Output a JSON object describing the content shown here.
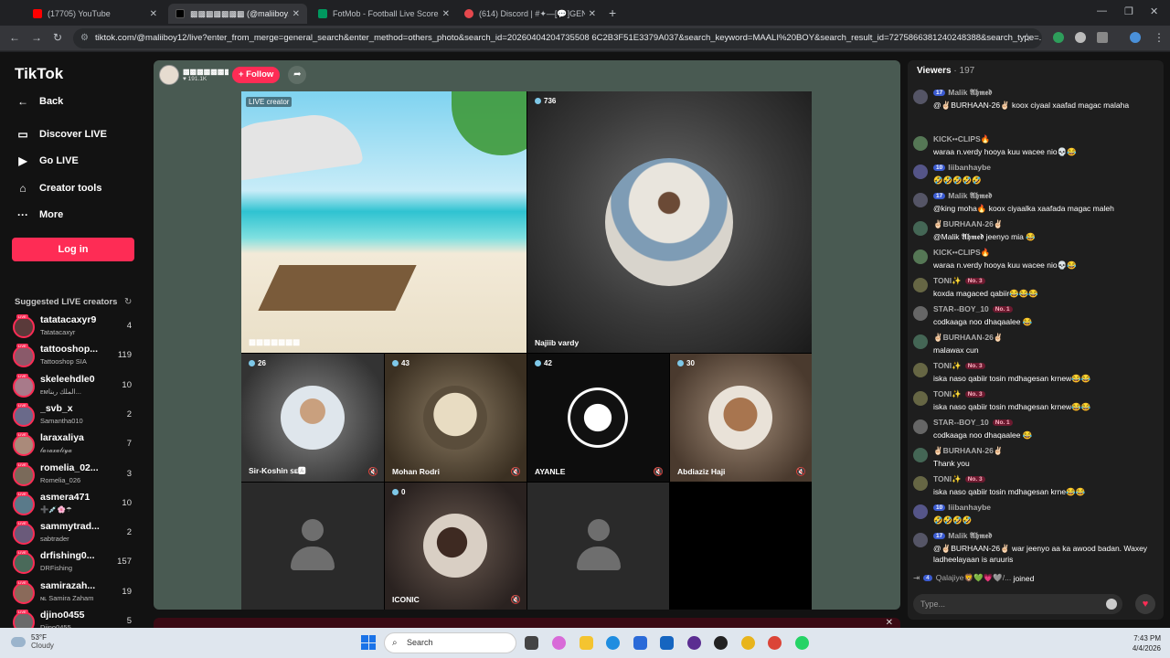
{
  "browser": {
    "tabs": [
      {
        "title": "(17705) YouTube",
        "color": "#ff0000"
      },
      {
        "title": "▩▩▩▩▩▩▩ (@maliiboy12...",
        "color": "#000000"
      },
      {
        "title": "FotMob - Football Live Scores",
        "color": "#00985f"
      },
      {
        "title": "(614) Discord | #✦—[💬]GENERAL",
        "color": "#5865f2"
      }
    ],
    "url": "tiktok.com/@maliiboy12/live?enter_from_merge=general_search&enter_method=others_photo&search_id=20260404204735508 6C2B3F51E3379A037&search_keyword=MAALI%20BOY&search_result_id=7275866381240248388&search_type=..."
  },
  "sidebar": {
    "logo": "TikTok",
    "nav": [
      {
        "label": "Back",
        "icon": "back-arrow-icon"
      },
      {
        "label": "Discover LIVE",
        "icon": "discover-live-icon"
      },
      {
        "label": "Go LIVE",
        "icon": "go-live-icon"
      },
      {
        "label": "Creator tools",
        "icon": "creator-tools-icon"
      },
      {
        "label": "More",
        "icon": "more-icon"
      }
    ],
    "login": "Log in",
    "suggested_heading": "Suggested LIVE creators",
    "creators": [
      {
        "name": "tatatacaxyr9",
        "sub": "Tatatacaxyr",
        "count": "4"
      },
      {
        "name": "tattooshop...",
        "sub": "Tattooshop SIA",
        "count": "119"
      },
      {
        "name": "skeleehdle0",
        "sub": "ᴇᴍالملك ربنا...",
        "count": "10"
      },
      {
        "name": "_svb_x",
        "sub": "Samantha010",
        "count": "2"
      },
      {
        "name": "laraxaliya",
        "sub": "𝓁𝒶𝓇𝒶𝓍𝒶𝓁𝒾𝓎𝒶",
        "count": "7"
      },
      {
        "name": "romelia_02...",
        "sub": "Romelia_026",
        "count": "3"
      },
      {
        "name": "asmera471",
        "sub": "➕💉🌸☂",
        "count": "10"
      },
      {
        "name": "sammytrad...",
        "sub": "sabtrader",
        "count": "2"
      },
      {
        "name": "drfishing0...",
        "sub": "DRFishing",
        "count": "157"
      },
      {
        "name": "samirazah...",
        "sub": "ɴʟ Samira Zaham",
        "count": "19"
      },
      {
        "name": "djino0455",
        "sub": "Djino0455",
        "count": "5"
      }
    ]
  },
  "stream": {
    "host_name": "▩▩▩▩▩▩▩",
    "host_likes": "♥ 191.1K",
    "follow": "+ Follow",
    "tiles": [
      {
        "name": "▩▩▩▩▩▩▩",
        "views": "",
        "badge": "LIVE creator"
      },
      {
        "name": "Najiib vardy",
        "views": "736"
      },
      {
        "name": "Sir-Koshin ꜱᴇ🅰",
        "views": "26"
      },
      {
        "name": "Mohan Rodri",
        "views": "43"
      },
      {
        "name": "AYANLE",
        "views": "42"
      },
      {
        "name": "Abdiaziz Haji",
        "views": "30"
      },
      {
        "name": "",
        "views": ""
      },
      {
        "name": "ICONIC",
        "views": "0"
      },
      {
        "name": "",
        "views": ""
      }
    ]
  },
  "chat": {
    "viewers_label": "Viewers",
    "viewers_count": "· 197",
    "messages": [
      {
        "user": "Malik 𝕬𝖍𝖒𝖊𝖉",
        "level": "17",
        "badge": "",
        "text": "@✌🏻BURHAAN-26✌🏻 koox ciyaal xaafad magac malaha"
      },
      {
        "user": "KICK••CLIPS🔥",
        "level": "",
        "badge": "",
        "text": "waraa n.verdy hooya kuu wacee nio💀😂"
      },
      {
        "user": "liibanhaybe",
        "level": "10",
        "badge": "",
        "text": "🤣🤣🤣🤣🤣"
      },
      {
        "user": "Malik 𝕬𝖍𝖒𝖊𝖉",
        "level": "17",
        "badge": "",
        "text": "@king moha🔥 koox ciyaalka xaafada magac maleh"
      },
      {
        "user": "✌🏻BURHAAN-26✌🏻",
        "level": "",
        "badge": "",
        "text": "@Malik 𝕬𝖍𝖒𝖊𝖉 jeenyo mia 😂"
      },
      {
        "user": "KICK••CLIPS🔥",
        "level": "",
        "badge": "",
        "text": "waraa n.verdy hooya kuu wacee nio💀😂"
      },
      {
        "user": "TONI✨",
        "level": "",
        "badge": "No. 3",
        "text": "koxda magaced qabiir😂😂😂"
      },
      {
        "user": "STAR--BOY_10",
        "level": "",
        "badge": "No. 1",
        "text": "codkaaga noo dhaqaalee 😂"
      },
      {
        "user": "✌🏻BURHAAN-26✌🏻",
        "level": "",
        "badge": "",
        "text": "malawax cun"
      },
      {
        "user": "TONI✨",
        "level": "",
        "badge": "No. 3",
        "text": "iska naso qabiir tosin mdhagesan krnew😂😂"
      },
      {
        "user": "TONI✨",
        "level": "",
        "badge": "No. 3",
        "text": "iska naso qabiir tosin mdhagesan krnew😂😂"
      },
      {
        "user": "STAR--BOY_10",
        "level": "",
        "badge": "No. 1",
        "text": "codkaaga noo dhaqaalee 😂"
      },
      {
        "user": "✌🏻BURHAAN-26✌🏻",
        "level": "",
        "badge": "",
        "text": "Thank you"
      },
      {
        "user": "TONI✨",
        "level": "",
        "badge": "No. 3",
        "text": "iska naso qabiir tosin mdhagesan krne😂😂"
      },
      {
        "user": "liibanhaybe",
        "level": "10",
        "badge": "",
        "text": "🤣🤣🤣🤣"
      },
      {
        "user": "Malik 𝕬𝖍𝖒𝖊𝖉",
        "level": "17",
        "badge": "",
        "text": "@✌🏻BURHAAN-26✌🏻 war jeenyo aa ka awood badan. Waxey ladheelayaan is aruuris"
      }
    ],
    "joined": {
      "level": "4",
      "user": "Qalajiye🦁💚💗🩶/...",
      "text": "joined"
    },
    "input_placeholder": "Type..."
  },
  "taskbar": {
    "temp": "53°F",
    "condition": "Cloudy",
    "search": "Search",
    "time": "7:43 PM",
    "date": "4/4/2026"
  }
}
